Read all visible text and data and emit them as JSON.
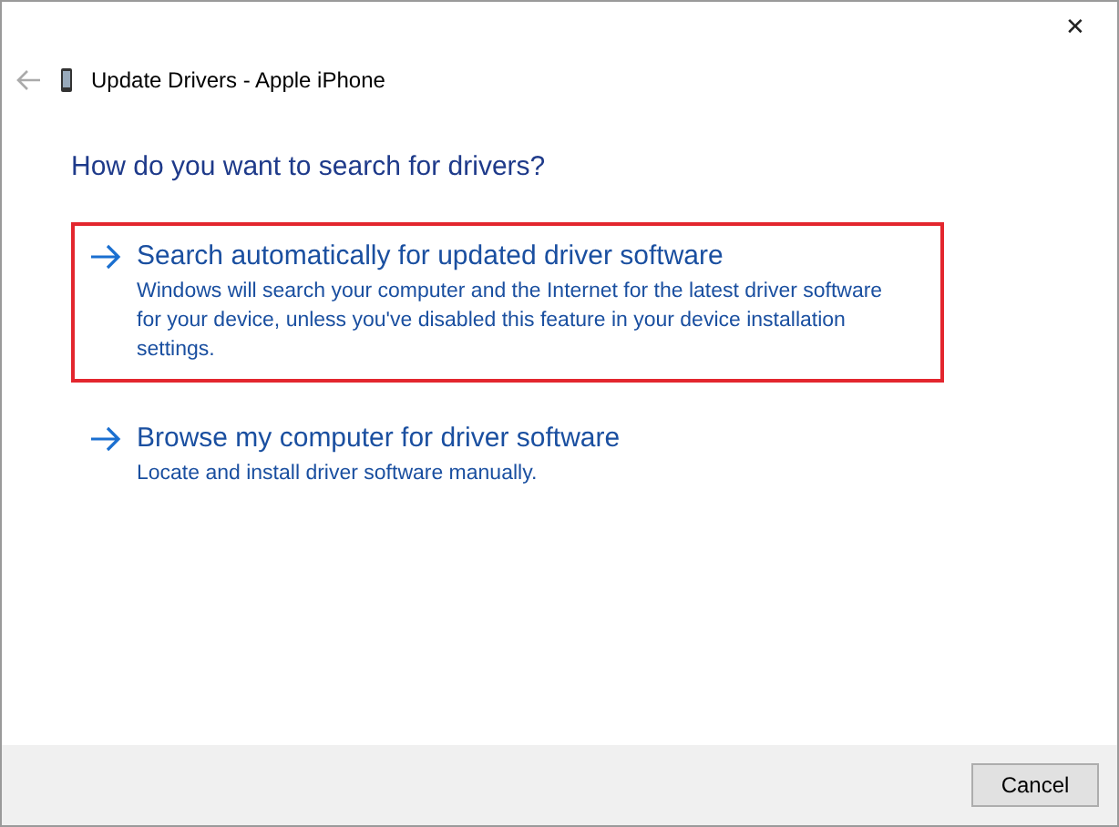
{
  "window": {
    "title": "Update Drivers - Apple iPhone",
    "close": "✕"
  },
  "heading": "How do you want to search for drivers?",
  "options": [
    {
      "title": "Search automatically for updated driver software",
      "description": "Windows will search your computer and the Internet for the latest driver software for your device, unless you've disabled this feature in your device installation settings.",
      "highlighted": true
    },
    {
      "title": "Browse my computer for driver software",
      "description": "Locate and install driver software manually.",
      "highlighted": false
    }
  ],
  "buttons": [
    "Cancel"
  ]
}
